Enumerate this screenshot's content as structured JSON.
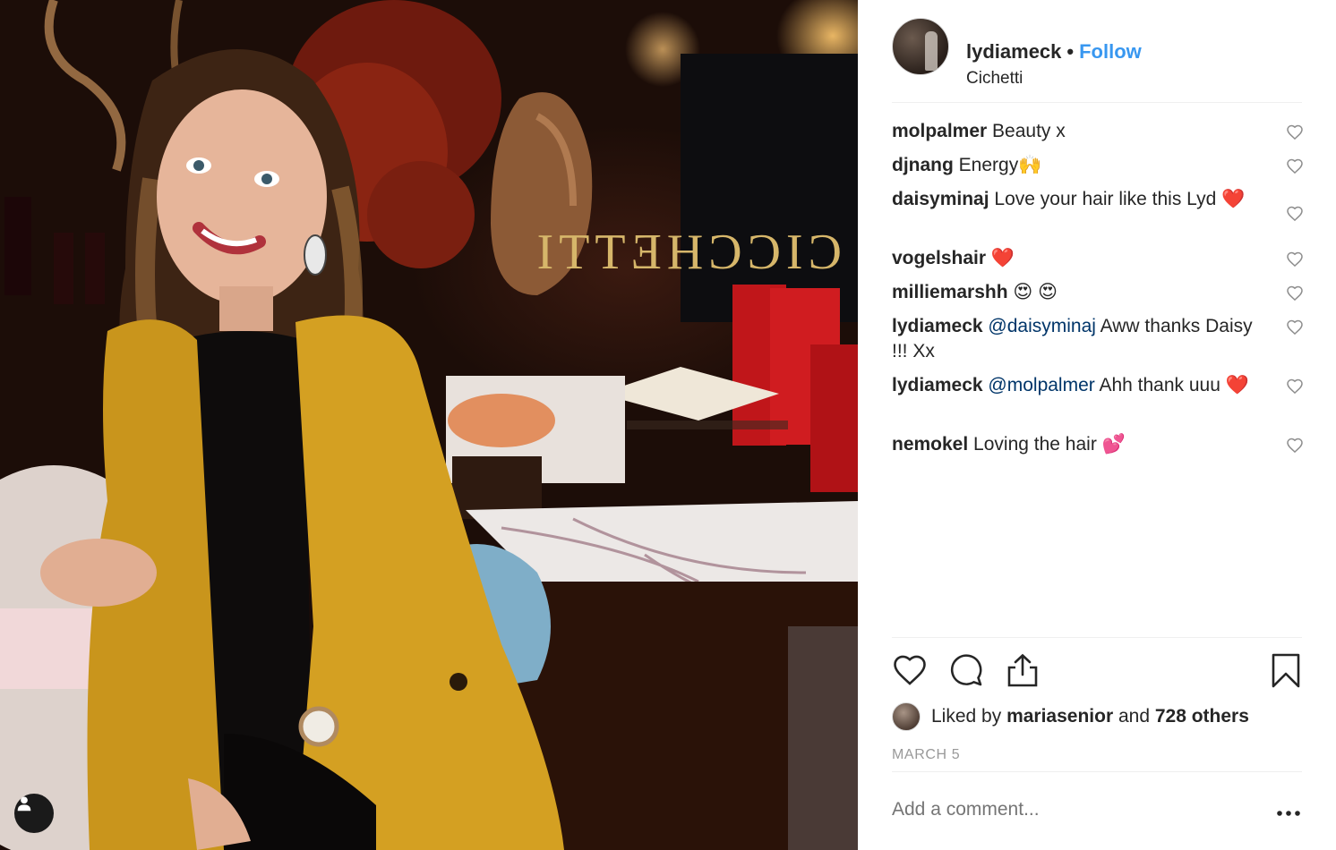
{
  "post": {
    "username": "lydiameck",
    "separator": "•",
    "follow_label": "Follow",
    "location": "Cichetti"
  },
  "comments": [
    {
      "user": "molpalmer",
      "mention": "",
      "text": "Beauty x"
    },
    {
      "user": "djnang",
      "mention": "",
      "text": "Energy🙌"
    },
    {
      "user": "daisyminaj",
      "mention": "",
      "text": "Love your hair like this Lyd ❤️"
    },
    {
      "user": "vogelshair",
      "mention": "",
      "text": "❤️"
    },
    {
      "user": "milliemarshh",
      "mention": "",
      "text": "😍 😍"
    },
    {
      "user": "lydiameck",
      "mention": "@daisyminaj",
      "text": "Aww thanks Daisy !!! Xx"
    },
    {
      "user": "lydiameck",
      "mention": "@molpalmer",
      "text": "Ahh thank uuu ❤️"
    },
    {
      "user": "nemokel",
      "mention": "",
      "text": "Loving the hair 💕"
    }
  ],
  "likes": {
    "prefix": "Liked by",
    "first_liker": "mariasenior",
    "joiner": "and",
    "others": "728 others"
  },
  "date": "MARCH 5",
  "add_comment": {
    "placeholder": "Add a comment..."
  },
  "icons": {
    "like": "heart-icon",
    "comment": "comment-bubble-icon",
    "share": "share-icon",
    "save": "bookmark-icon",
    "more": "more-options-icon",
    "tag": "user-tag-icon"
  },
  "colors": {
    "follow": "#3897f0",
    "mention": "#003569",
    "muted": "#999999",
    "heart_emoji": "#ed1c24"
  }
}
